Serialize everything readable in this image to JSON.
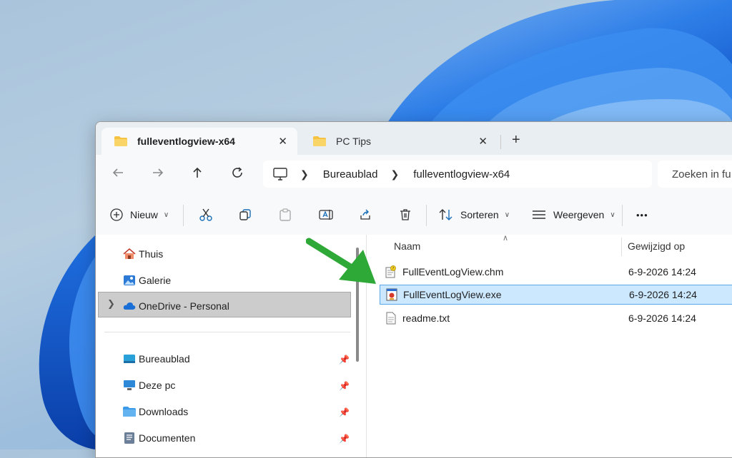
{
  "window": {
    "tabs": [
      {
        "label": "fulleventlogview-x64",
        "active": true
      },
      {
        "label": "PC Tips",
        "active": false
      }
    ],
    "new_tab_label": "+",
    "tab_close_label": "✕"
  },
  "navigation": {
    "back_icon": "arrow-left-icon",
    "forward_icon": "arrow-right-icon",
    "up_icon": "arrow-up-icon",
    "refresh_icon": "refresh-icon",
    "breadcrumb": [
      "Bureaublad",
      "fulleventlogview-x64"
    ],
    "search_placeholder": "Zoeken in fu"
  },
  "toolbar": {
    "new_label": "Nieuw",
    "sort_label": "Sorteren",
    "view_label": "Weergeven",
    "more_label": "•••"
  },
  "sidebar": {
    "items": [
      {
        "label": "Thuis",
        "icon": "home-icon"
      },
      {
        "label": "Galerie",
        "icon": "gallery-icon"
      },
      {
        "label": "OneDrive - Personal",
        "icon": "cloud-icon",
        "selected": true
      }
    ],
    "quick_access": [
      {
        "label": "Bureaublad",
        "icon": "desktop-icon"
      },
      {
        "label": "Deze pc",
        "icon": "monitor-icon"
      },
      {
        "label": "Downloads",
        "icon": "downloads-folder-icon"
      },
      {
        "label": "Documenten",
        "icon": "documents-icon"
      }
    ]
  },
  "filelist": {
    "columns": [
      "Naam",
      "Gewijzigd op"
    ],
    "rows": [
      {
        "name": "FullEventLogView.chm",
        "modified": "6-9-2026 14:24",
        "icon": "chm-help-file-icon"
      },
      {
        "name": "FullEventLogView.exe",
        "modified": "6-9-2026 14:24",
        "icon": "exe-app-icon",
        "selected": true
      },
      {
        "name": "readme.txt",
        "modified": "6-9-2026 14:24",
        "icon": "text-file-icon"
      }
    ]
  },
  "colors": {
    "accent_green_arrow": "#2ea836",
    "selection_blue": "#cce8ff",
    "selection_border": "#5aa6e6",
    "folder_yellow": "#f5c242",
    "wallpaper_blue": "#1f6fe0"
  }
}
